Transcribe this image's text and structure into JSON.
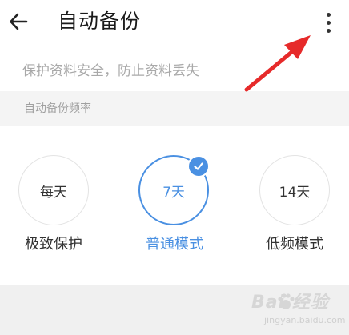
{
  "header": {
    "title": "自动备份",
    "back_icon": "arrow-left-icon",
    "more_icon": "more-vertical-icon"
  },
  "description": "保护资料安全，防止资料丢失",
  "section_label": "自动备份频率",
  "options": [
    {
      "value": "每天",
      "label": "极致保护",
      "selected": false
    },
    {
      "value": "7天",
      "label": "普通模式",
      "selected": true
    },
    {
      "value": "14天",
      "label": "低频模式",
      "selected": false
    }
  ],
  "colors": {
    "accent": "#4a90e2",
    "annotation_arrow": "#e62a2a"
  },
  "watermark": {
    "main": "Bai 经验",
    "sub": "jingyan.baidu.com"
  }
}
